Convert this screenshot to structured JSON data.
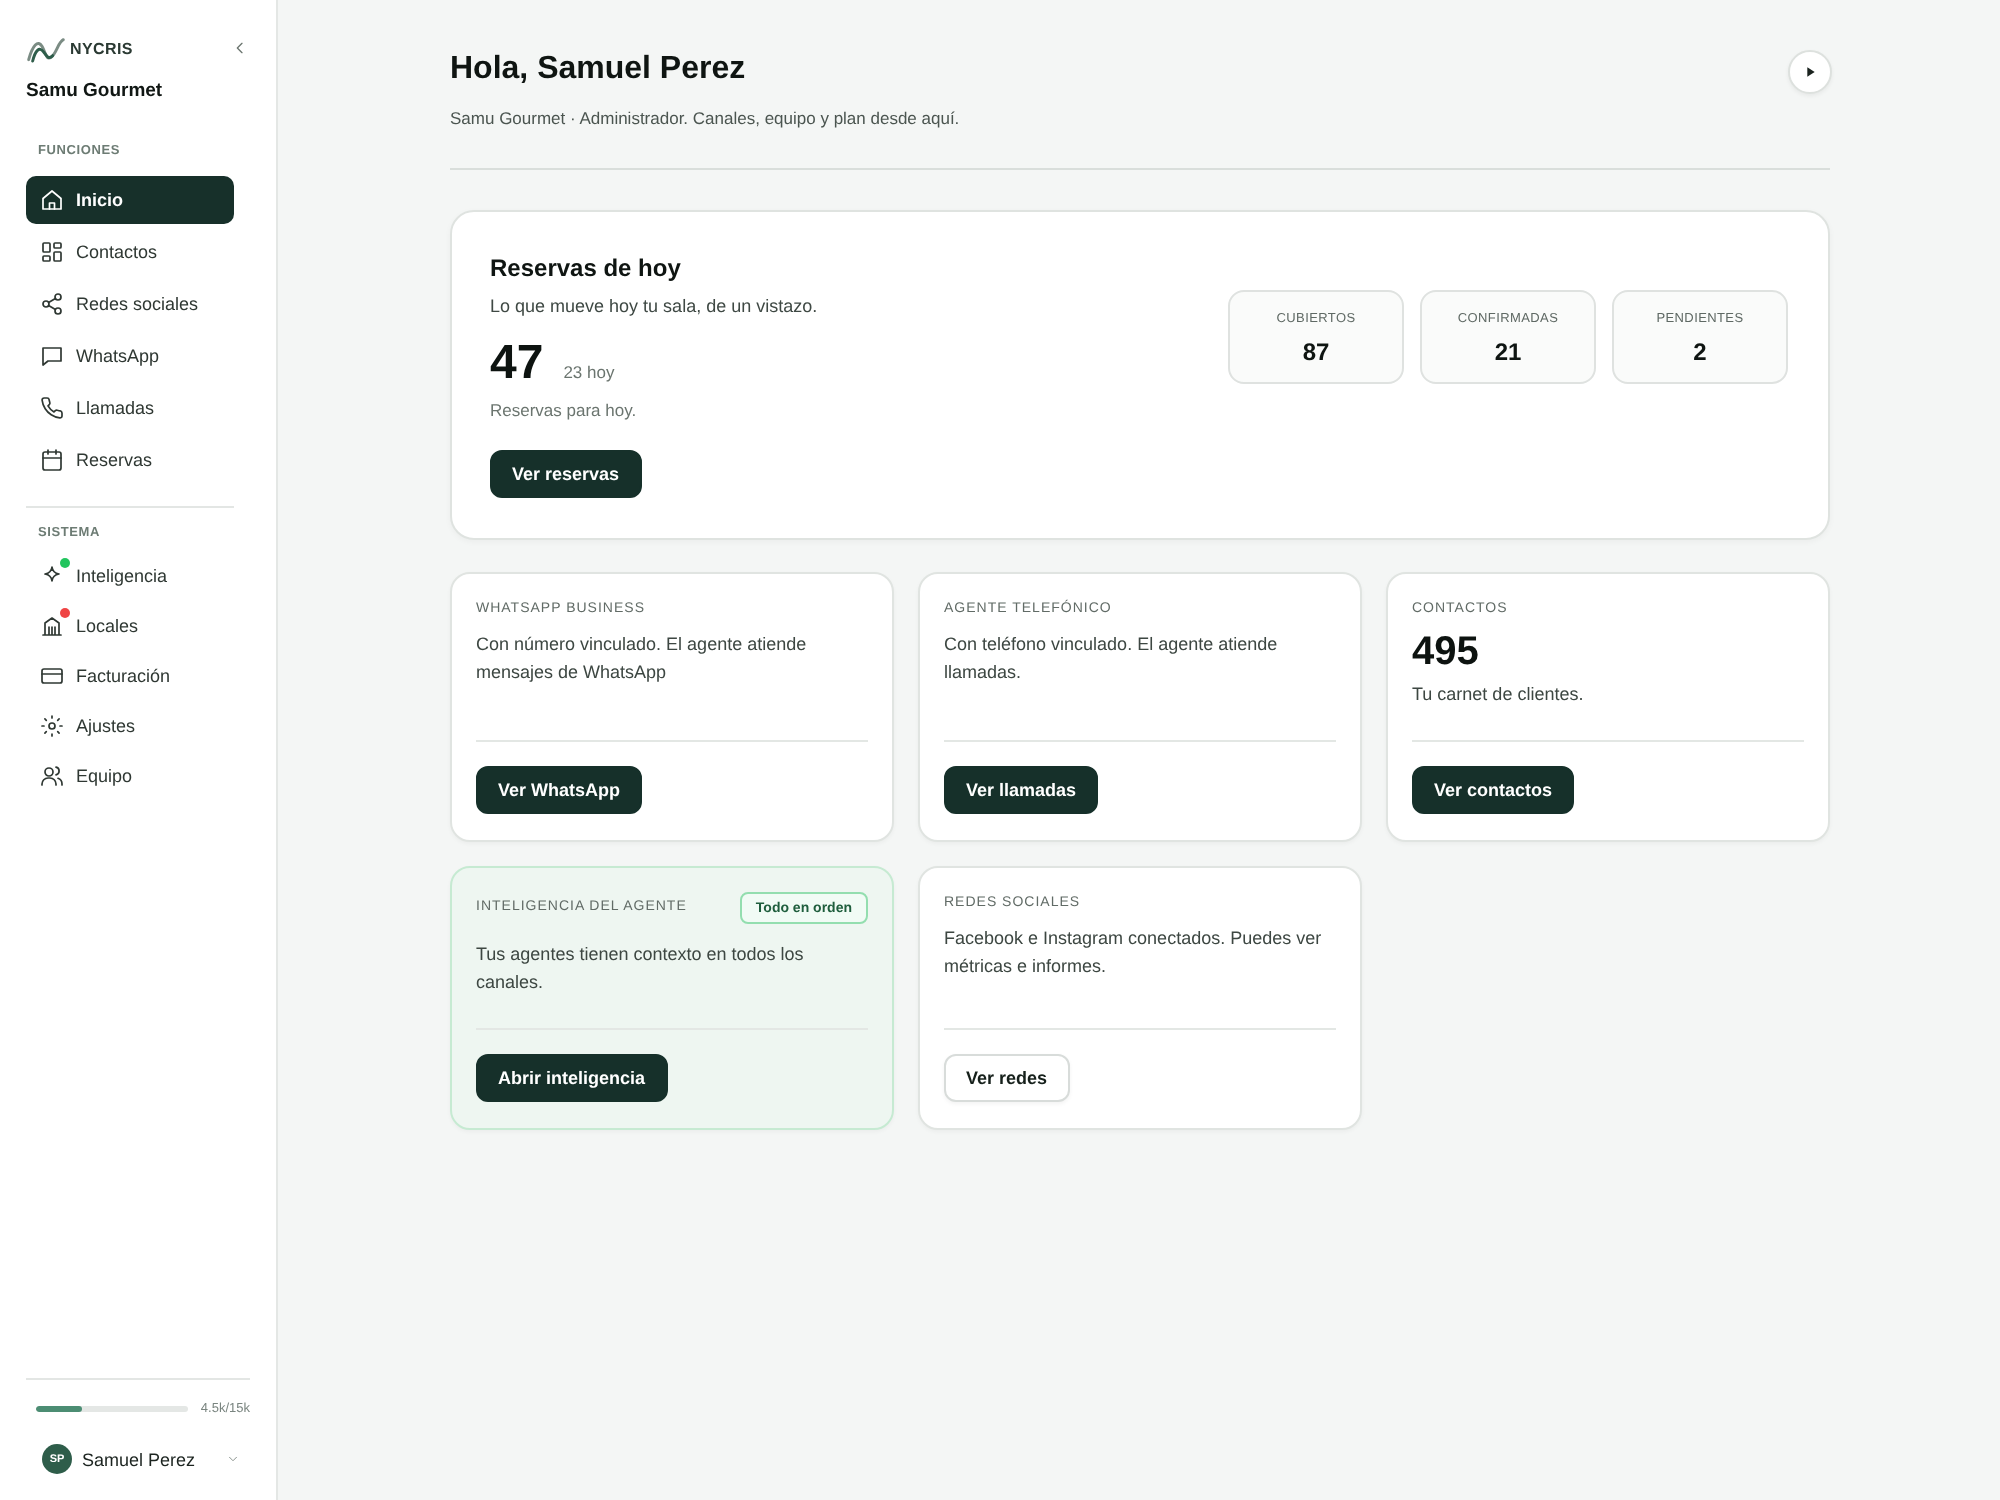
{
  "sidebar": {
    "brand": "NYCRIS",
    "workspace": "Samu Gourmet",
    "sections": [
      {
        "title": "FUNCIONES",
        "items": [
          {
            "label": "Inicio",
            "selected": true
          },
          {
            "label": "Contactos",
            "selected": false
          },
          {
            "label": "Redes sociales",
            "selected": false
          },
          {
            "label": "WhatsApp",
            "selected": false
          },
          {
            "label": "Llamadas",
            "selected": false
          },
          {
            "label": "Reservas",
            "selected": false
          }
        ]
      },
      {
        "title": "SISTEMA",
        "items": [
          {
            "label": "Inteligencia",
            "selected": false,
            "color": "#22c55e"
          },
          {
            "label": "Locales",
            "selected": false,
            "color": "#ef4444"
          },
          {
            "label": "Facturación",
            "selected": false
          },
          {
            "label": "Ajustes",
            "selected": false
          },
          {
            "label": "Equipo",
            "selected": false
          }
        ]
      }
    ],
    "usage": {
      "level": 0.3,
      "reading": "4.5k/15k"
    },
    "user": {
      "initials": "SP",
      "name": "Samuel Perez"
    }
  },
  "header": {
    "title": "Hola, Samuel Perez",
    "subtitle": "Samu Gourmet · Administrador. Canales, equipo y plan desde aquí."
  },
  "reservations": {
    "title": "Reservas de hoy",
    "subtitle": "Lo que mueve hoy tu sala, de un vistazo.",
    "count": "47",
    "note": "23 hoy",
    "caption": "Reservas para hoy.",
    "button": "Ver reservas",
    "stats": [
      {
        "label": "CUBIERTOS",
        "value": "87"
      },
      {
        "label": "CONFIRMADAS",
        "value": "21"
      },
      {
        "label": "PENDIENTES",
        "value": "2"
      }
    ]
  },
  "cards": [
    {
      "kind": "text",
      "label": "WHATSAPP BUSINESS",
      "text": "Con número vinculado. El agente atiende mensajes de WhatsApp",
      "button": {
        "label": "Ver WhatsApp",
        "kind": "primary"
      }
    },
    {
      "kind": "text",
      "label": "AGENTE TELEFÓNICO",
      "text": "Con teléfono vinculado. El agente atiende llamadas.",
      "button": {
        "label": "Ver llamadas",
        "kind": "primary"
      }
    },
    {
      "kind": "metric",
      "label": "CONTACTOS",
      "value": "495",
      "text": "Tu carnet de clientes.",
      "button": {
        "label": "Ver contactos",
        "kind": "primary"
      }
    },
    {
      "kind": "highlight",
      "label": "INTELIGENCIA DEL AGENTE",
      "badge": "Todo en orden",
      "text": "Tus agentes tienen contexto en todos los canales.",
      "button": {
        "label": "Abrir inteligencia",
        "kind": "primary"
      }
    },
    {
      "kind": "text",
      "label": "REDES SOCIALES",
      "text": "Facebook e Instagram conectados. Puedes ver métricas e informes.",
      "button": {
        "label": "Ver redes",
        "kind": "secondary"
      }
    }
  ]
}
